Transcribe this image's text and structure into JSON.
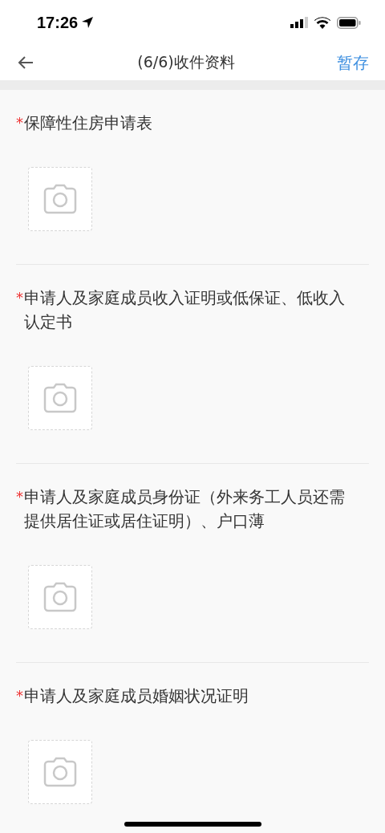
{
  "status_bar": {
    "time": "17:26"
  },
  "nav": {
    "title": "(6/6)收件资料",
    "action": "暂存"
  },
  "fields": [
    {
      "mark": "*",
      "label": "保障性住房申请表"
    },
    {
      "mark": "*",
      "label": "申请人及家庭成员收入证明或低保证、低收入认定书"
    },
    {
      "mark": "*",
      "label": "申请人及家庭成员身份证（外来务工人员还需提供居住证或居住证明）、户口薄"
    },
    {
      "mark": "*",
      "label": "申请人及家庭成员婚姻状况证明"
    }
  ]
}
